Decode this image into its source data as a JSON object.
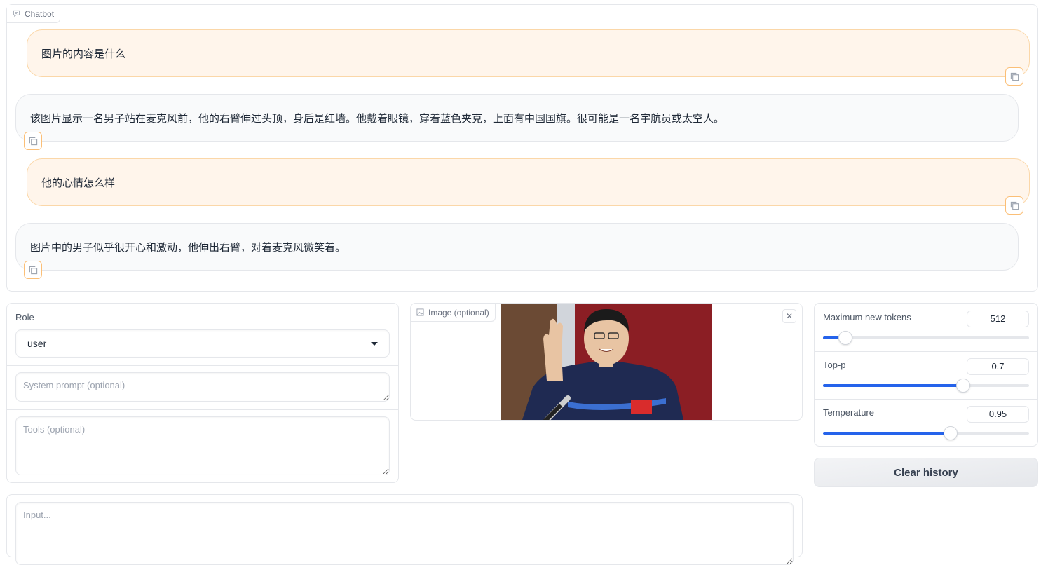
{
  "chatbot": {
    "label": "Chatbot",
    "messages": [
      {
        "role": "user",
        "text": "图片的内容是什么"
      },
      {
        "role": "assistant",
        "text": "该图片显示一名男子站在麦克风前，他的右臂伸过头顶，身后是红墙。他戴着眼镜，穿着蓝色夹克，上面有中国国旗。很可能是一名宇航员或太空人。"
      },
      {
        "role": "user",
        "text": "他的心情怎么样"
      },
      {
        "role": "assistant",
        "text": "图片中的男子似乎很开心和激动，他伸出右臂，对着麦克风微笑着。"
      }
    ]
  },
  "settings": {
    "role_label": "Role",
    "role_value": "user",
    "system_prompt_placeholder": "System prompt (optional)",
    "tools_placeholder": "Tools (optional)"
  },
  "image_upload": {
    "label": "Image (optional)",
    "image_alt": "Man in navy blue astronaut uniform with Chinese flag waving in front of microphone and red wall"
  },
  "sliders": [
    {
      "label": "Maximum new tokens",
      "value": "512",
      "fraction": 0.11
    },
    {
      "label": "Top-p",
      "value": "0.7",
      "fraction": 0.68
    },
    {
      "label": "Temperature",
      "value": "0.95",
      "fraction": 0.62
    }
  ],
  "clear_button": "Clear history",
  "input": {
    "placeholder": "Input..."
  },
  "colors": {
    "accent": "#2563eb",
    "user_bubble": "#fff5eb",
    "user_border": "#fbd7a8",
    "copy_border": "#fbbf77"
  }
}
